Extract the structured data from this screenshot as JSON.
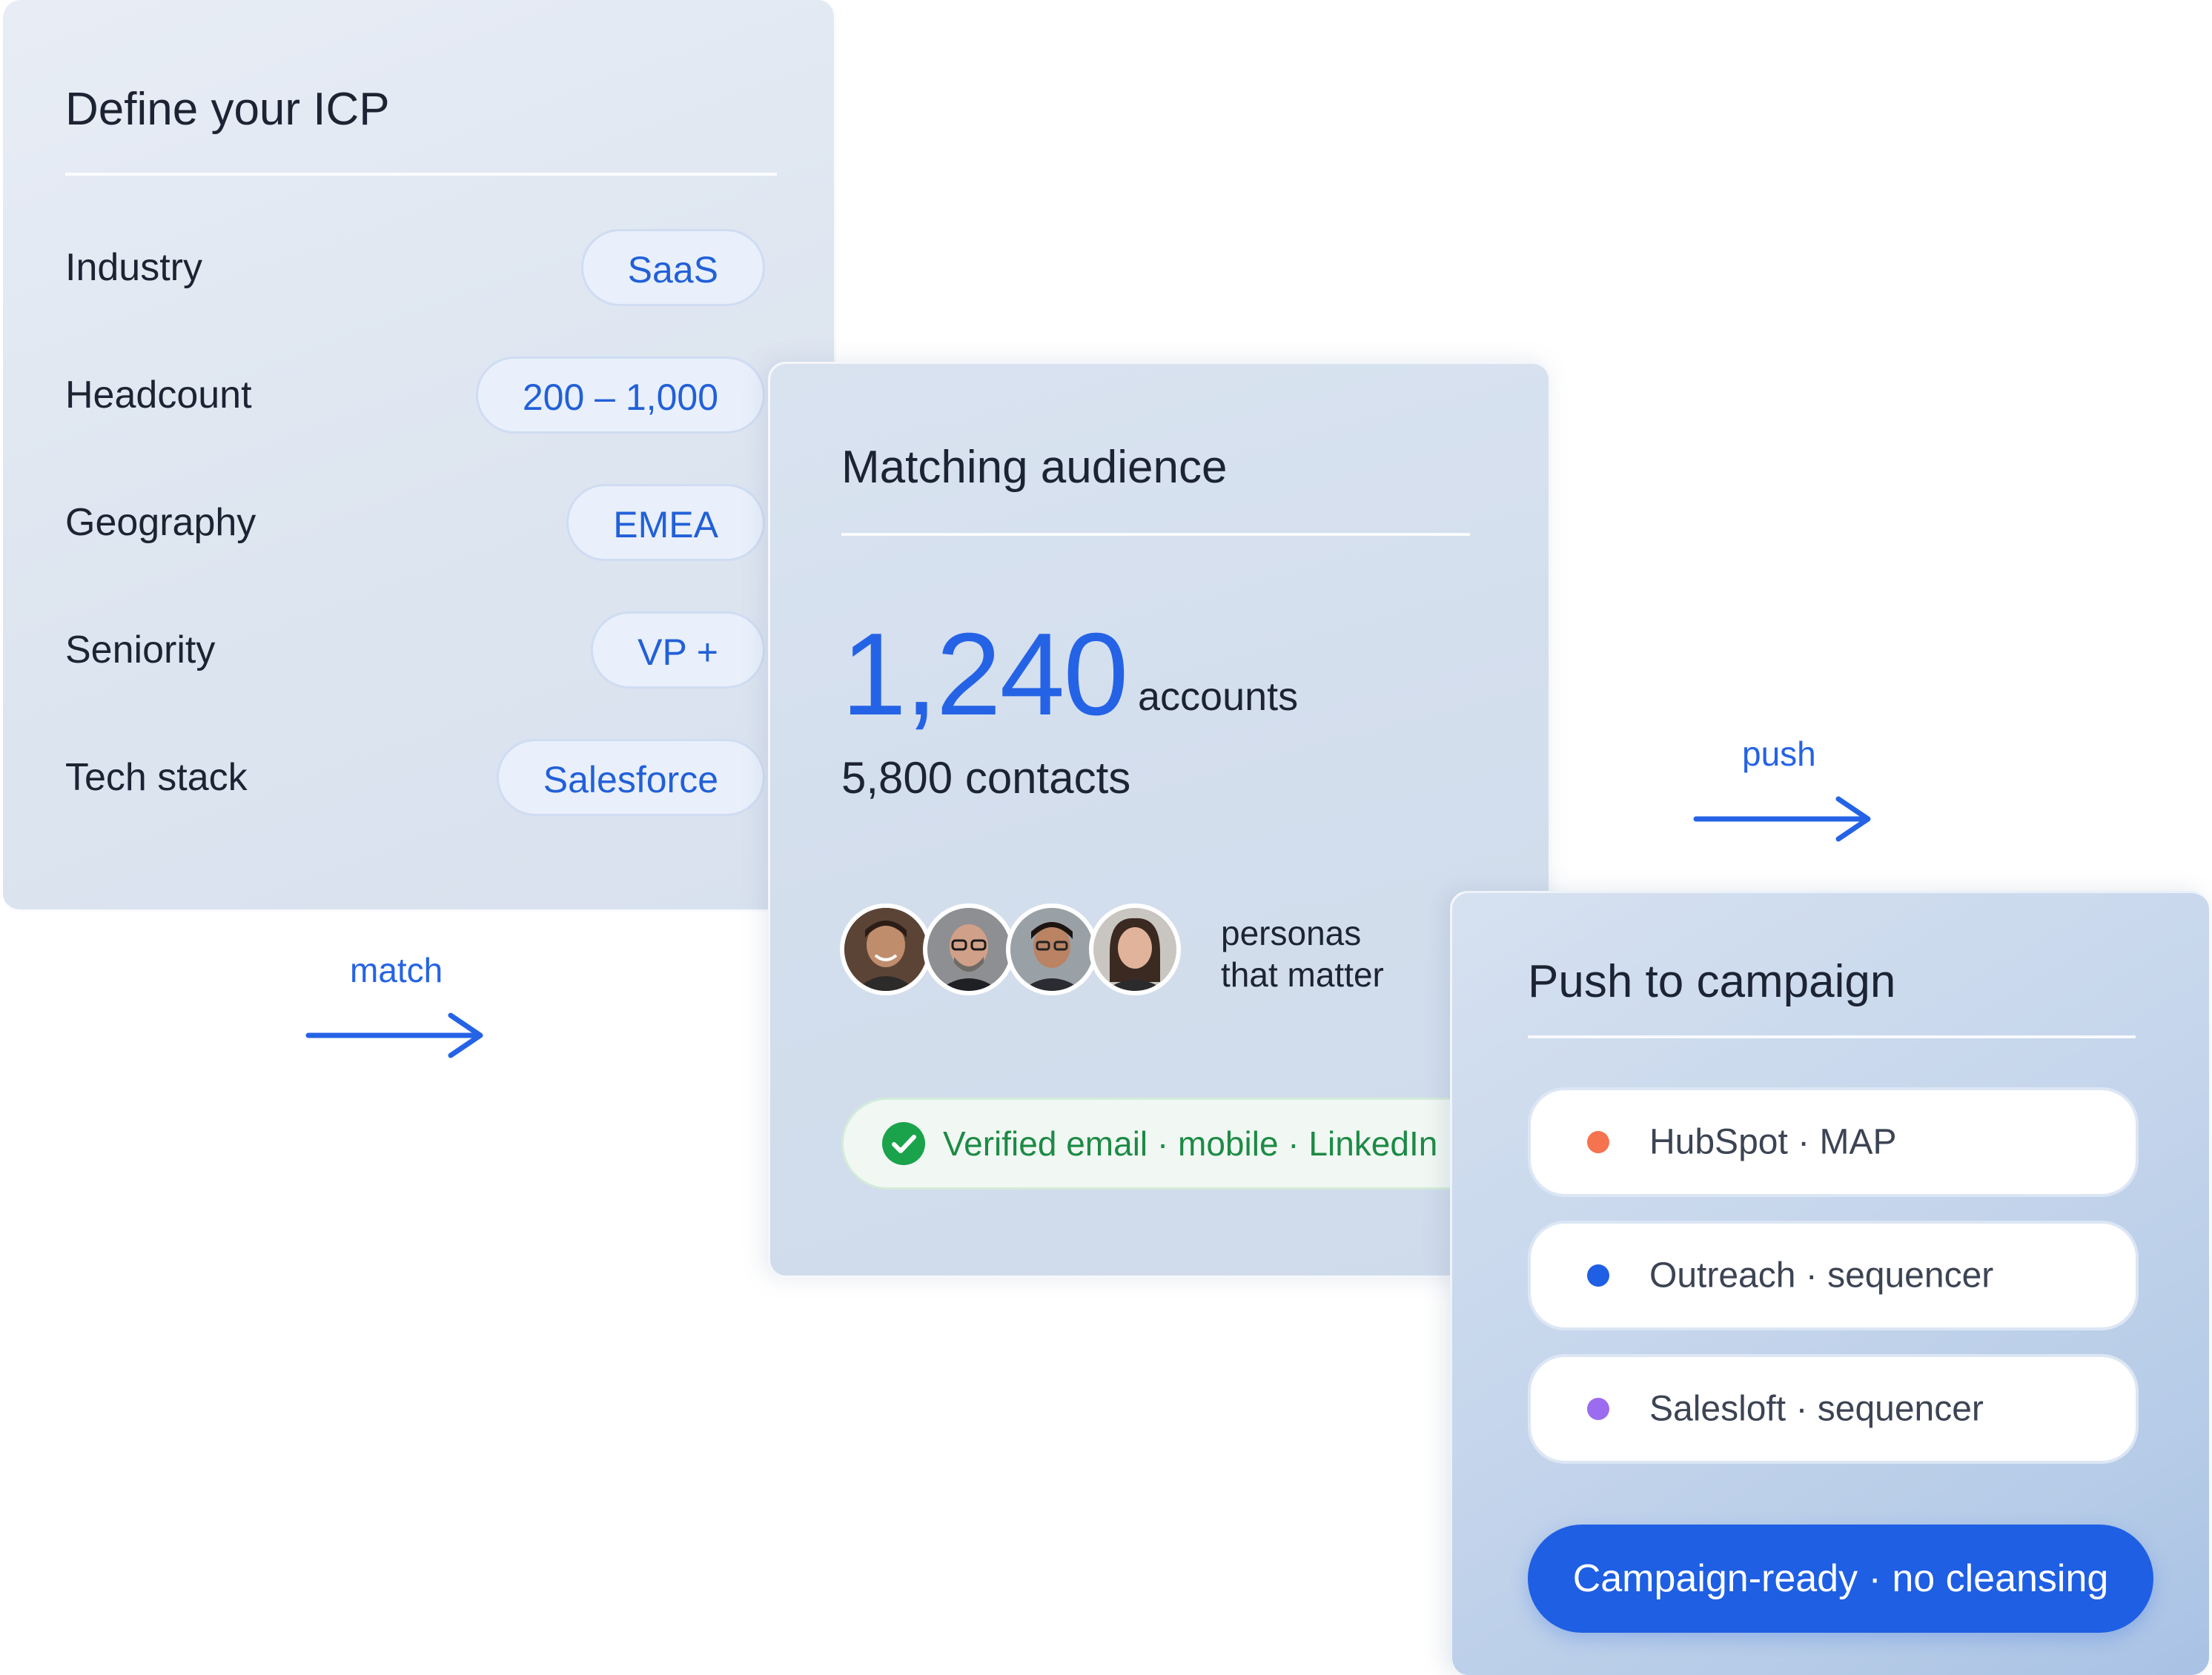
{
  "icp_card": {
    "title": "Define your ICP",
    "rows": [
      {
        "label": "Industry",
        "value": "SaaS"
      },
      {
        "label": "Headcount",
        "value": "200 – 1,000"
      },
      {
        "label": "Geography",
        "value": "EMEA"
      },
      {
        "label": "Seniority",
        "value": "VP +"
      },
      {
        "label": "Tech stack",
        "value": "Salesforce"
      }
    ]
  },
  "arrows": {
    "match_label": "match",
    "push_label": "push",
    "color": "#2563e6"
  },
  "audience_card": {
    "title": "Matching audience",
    "accounts_count": "1,240",
    "accounts_unit": "accounts",
    "contacts": "5,800 contacts",
    "personas_line1": "personas",
    "personas_line2": "that matter",
    "verified": "Verified email · mobile · LinkedIn",
    "accent": "#2563e6",
    "verified_color": "#1d8a45"
  },
  "push_card": {
    "title": "Push to campaign",
    "destinations": [
      {
        "label": "HubSpot · MAP",
        "dot_color": "#f5734f"
      },
      {
        "label": "Outreach · sequencer",
        "dot_color": "#1e5fe3"
      },
      {
        "label": "Salesloft · sequencer",
        "dot_color": "#9b6cf0"
      }
    ],
    "cta": "Campaign-ready · no cleansing",
    "cta_color": "#1e5fe3"
  }
}
